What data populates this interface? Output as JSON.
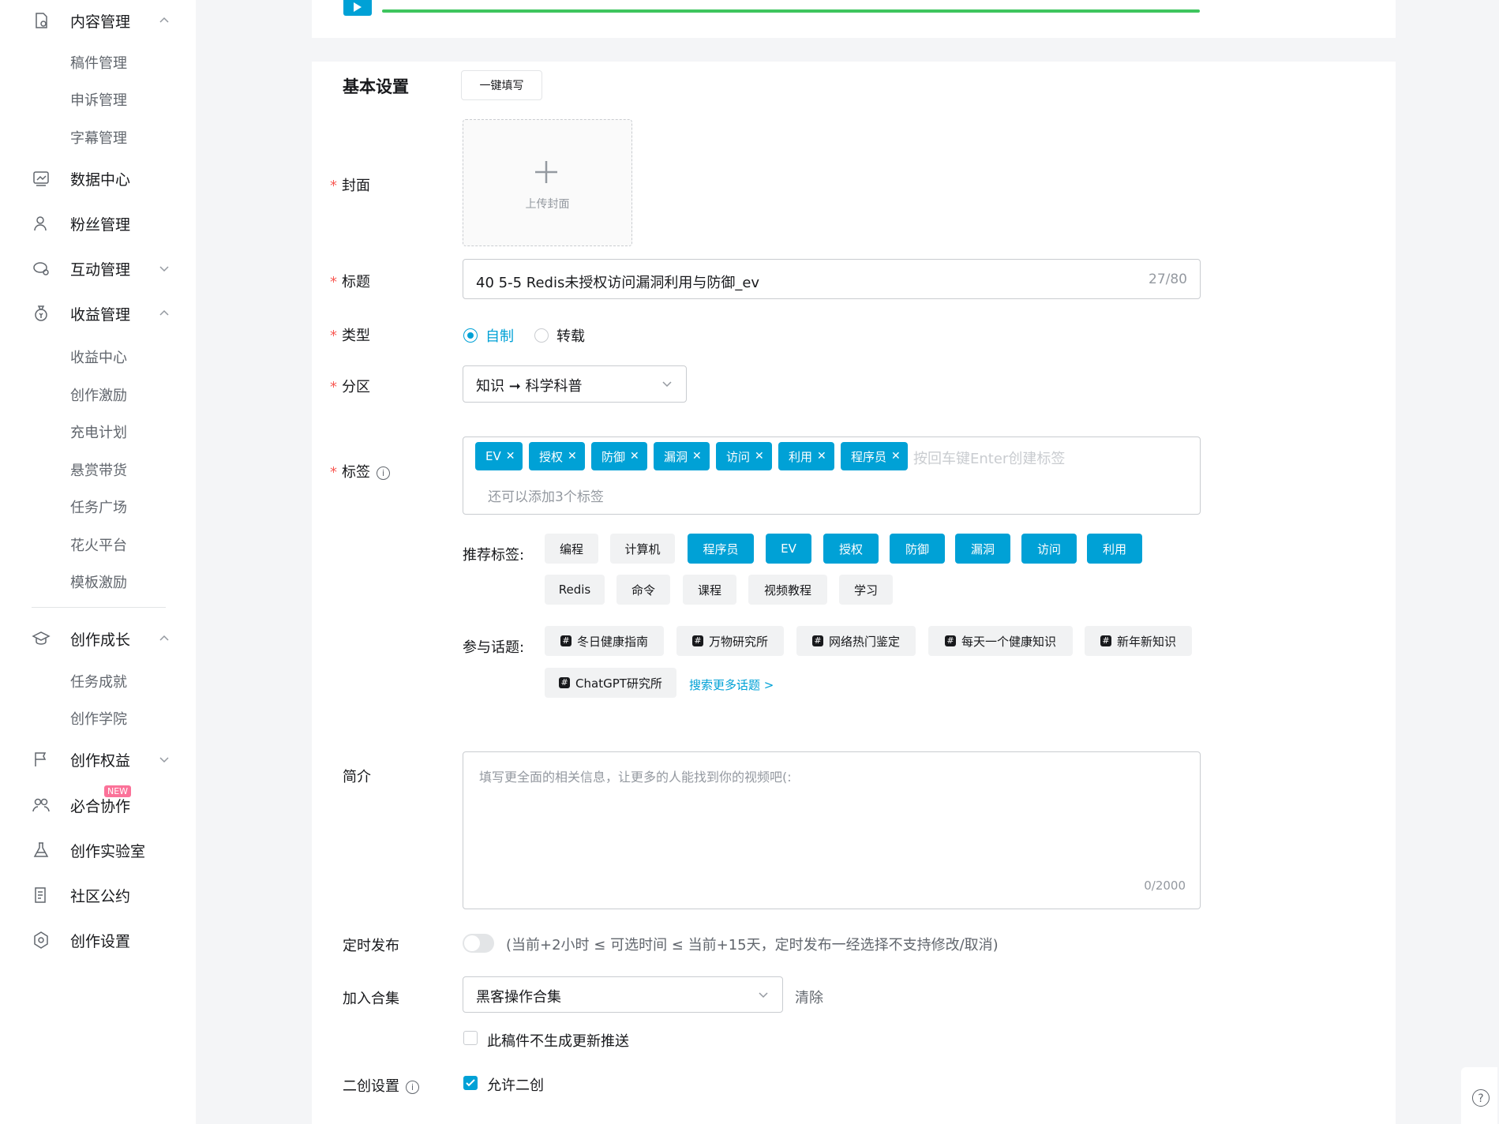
{
  "sidebar": {
    "content_mgmt": "内容管理",
    "content_sub": [
      "稿件管理",
      "申诉管理",
      "字幕管理"
    ],
    "data_center": "数据中心",
    "fans_mgmt": "粉丝管理",
    "interaction_mgmt": "互动管理",
    "income_mgmt": "收益管理",
    "income_sub": [
      "收益中心",
      "创作激励",
      "充电计划",
      "悬赏带货",
      "任务广场",
      "花火平台",
      "模板激励"
    ],
    "growth": "创作成长",
    "growth_sub": [
      "任务成就",
      "创作学院"
    ],
    "rights": "创作权益",
    "cooperation": "必合协作",
    "cooperation_badge": "NEW",
    "lab": "创作实验室",
    "community": "社区公约",
    "settings": "创作设置"
  },
  "upload": {
    "progress": 1.0
  },
  "form": {
    "section_title": "基本设置",
    "one_click_fill": "一键填写",
    "cover_label": "封面",
    "cover_upload": "上传封面",
    "title_label": "标题",
    "title_value": "40 5-5 Redis未授权访问漏洞利用与防御_ev",
    "title_count": "27/80",
    "type_label": "类型",
    "type_options": [
      "自制",
      "转载"
    ],
    "type_selected": "自制",
    "partition_label": "分区",
    "partition_value": "知识 ➞ 科学科普",
    "tags_label": "标签",
    "tags": [
      "EV",
      "授权",
      "防御",
      "漏洞",
      "访问",
      "利用",
      "程序员"
    ],
    "tags_placeholder": "按回车键Enter创建标签",
    "tags_hint": "还可以添加3个标签",
    "recommended_label": "推荐标签:",
    "recommended": [
      {
        "label": "编程",
        "selected": false
      },
      {
        "label": "计算机",
        "selected": false
      },
      {
        "label": "程序员",
        "selected": true
      },
      {
        "label": "EV",
        "selected": true
      },
      {
        "label": "授权",
        "selected": true
      },
      {
        "label": "防御",
        "selected": true
      },
      {
        "label": "漏洞",
        "selected": true
      },
      {
        "label": "访问",
        "selected": true
      },
      {
        "label": "利用",
        "selected": true
      },
      {
        "label": "Redis",
        "selected": false
      },
      {
        "label": "命令",
        "selected": false
      },
      {
        "label": "课程",
        "selected": false
      },
      {
        "label": "视频教程",
        "selected": false
      },
      {
        "label": "学习",
        "selected": false
      }
    ],
    "topics_label": "参与话题:",
    "topics": [
      "冬日健康指南",
      "万物研究所",
      "网络热门鉴定",
      "每天一个健康知识",
      "新年新知识",
      "ChatGPT研究所"
    ],
    "more_topics": "搜索更多话题 >",
    "desc_label": "简介",
    "desc_placeholder": "填写更全面的相关信息，让更多的人能找到你的视频吧(:",
    "desc_count": "0/2000",
    "schedule_label": "定时发布",
    "schedule_enabled": false,
    "schedule_hint": "(当前+2小时 ≤ 可选时间 ≤ 当前+15天，定时发布一经选择不支持修改/取消)",
    "collection_label": "加入合集",
    "collection_value": "黑客操作合集",
    "collection_clear": "清除",
    "no_push_label": "此稿件不生成更新推送",
    "no_push_checked": false,
    "derivative_label": "二创设置",
    "derivative_option": "允许二创",
    "derivative_checked": true
  },
  "help": "?",
  "colors": {
    "accent": "#00a1d6",
    "progress": "#3ec55e",
    "required": "#f85a54",
    "badge": "#fb7299"
  }
}
